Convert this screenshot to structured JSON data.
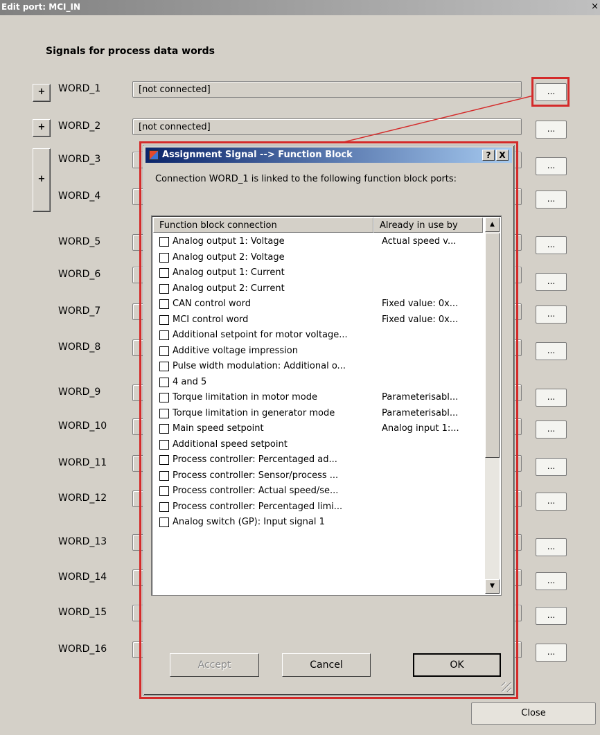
{
  "window": {
    "title": "Edit port: MCI_IN",
    "close_glyph": "×"
  },
  "heading": "Signals for process data words",
  "plus_label": "+",
  "words": [
    {
      "label": "WORD_1",
      "value": "[not connected]"
    },
    {
      "label": "WORD_2",
      "value": "[not connected]"
    },
    {
      "label": "WORD_3",
      "value": ""
    },
    {
      "label": "WORD_4",
      "value": ""
    },
    {
      "label": "WORD_5",
      "value": ""
    },
    {
      "label": "WORD_6",
      "value": ""
    },
    {
      "label": "WORD_7",
      "value": ""
    },
    {
      "label": "WORD_8",
      "value": ""
    },
    {
      "label": "WORD_9",
      "value": ""
    },
    {
      "label": "WORD_10",
      "value": ""
    },
    {
      "label": "WORD_11",
      "value": ""
    },
    {
      "label": "WORD_12",
      "value": ""
    },
    {
      "label": "WORD_13",
      "value": ""
    },
    {
      "label": "WORD_14",
      "value": ""
    },
    {
      "label": "WORD_15",
      "value": ""
    },
    {
      "label": "WORD_16",
      "value": ""
    }
  ],
  "browse_label": "...",
  "close_button": "Close",
  "dialog": {
    "title": "Assignment Signal --> Function Block",
    "help_glyph": "?",
    "close_glyph": "X",
    "description": "Connection WORD_1 is linked to the following function block ports:",
    "columns": [
      "Function block connection",
      "Already in use by"
    ],
    "rows": [
      {
        "name": "Analog output 1: Voltage",
        "in_use": "Actual speed v..."
      },
      {
        "name": "Analog output 2: Voltage",
        "in_use": ""
      },
      {
        "name": "Analog output 1: Current",
        "in_use": ""
      },
      {
        "name": "Analog output 2: Current",
        "in_use": ""
      },
      {
        "name": "CAN control word",
        "in_use": "Fixed value: 0x..."
      },
      {
        "name": "MCI control word",
        "in_use": "Fixed value: 0x..."
      },
      {
        "name": "Additional setpoint for motor voltage...",
        "in_use": ""
      },
      {
        "name": "Additive voltage impression",
        "in_use": ""
      },
      {
        "name": "Pulse width modulation: Additional o...",
        "in_use": ""
      },
      {
        "name": " 4 and 5",
        "in_use": ""
      },
      {
        "name": "Torque limitation in motor mode",
        "in_use": "Parameterisabl..."
      },
      {
        "name": "Torque limitation in generator mode",
        "in_use": "Parameterisabl..."
      },
      {
        "name": "Main speed setpoint",
        "in_use": "Analog input 1:..."
      },
      {
        "name": "Additional speed setpoint",
        "in_use": ""
      },
      {
        "name": "Process controller: Percentaged ad...",
        "in_use": ""
      },
      {
        "name": "Process controller: Sensor/process ...",
        "in_use": ""
      },
      {
        "name": "Process controller: Actual speed/se...",
        "in_use": ""
      },
      {
        "name": "Process controller: Percentaged limi...",
        "in_use": ""
      },
      {
        "name": "Analog switch (GP): Input signal 1",
        "in_use": ""
      }
    ],
    "scroll_up": "▲",
    "scroll_down": "▼",
    "accept": "Accept",
    "cancel": "Cancel",
    "ok": "OK"
  },
  "colors": {
    "highlight": "#d42a2a",
    "title_active": "#0a246a",
    "face": "#d4d0c8"
  }
}
